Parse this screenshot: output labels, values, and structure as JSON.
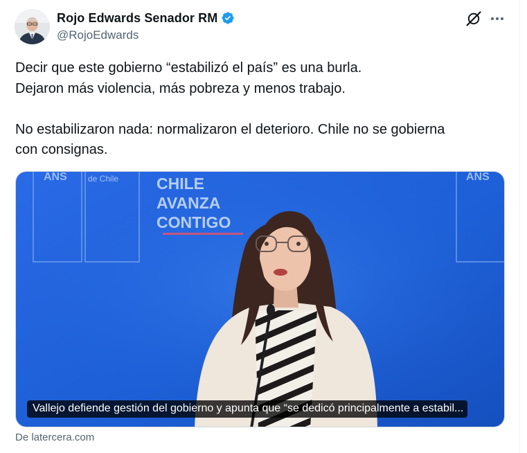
{
  "author": {
    "display_name": "Rojo Edwards Senador RM",
    "handle": "@RojoEdwards",
    "verified": true
  },
  "actions": {
    "grok_icon": "grok-icon",
    "more_icon": "more-icon"
  },
  "tweet": {
    "lines_1": [
      "Decir que este gobierno “estabilizó el país” es una burla.",
      "Dejaron más violencia, más pobreza y menos trabajo."
    ],
    "lines_2": [
      "No estabilizaron nada: normalizaron el deterioro. Chile no se gobierna",
      "con consignas."
    ]
  },
  "media": {
    "backdrop_text": [
      "CHILE",
      "AVANZA",
      "CONTIGO"
    ],
    "backdrop_left_text": "de Chile",
    "caption": "Vallejo defiende gestión del gobierno y apunta que “se dedicó principalmente a estabil..."
  },
  "link_source": "De latercera.com",
  "colors": {
    "verified_blue": "#1d9bf0",
    "backdrop_blue": "#1d5fd6",
    "text_secondary": "#536471"
  }
}
